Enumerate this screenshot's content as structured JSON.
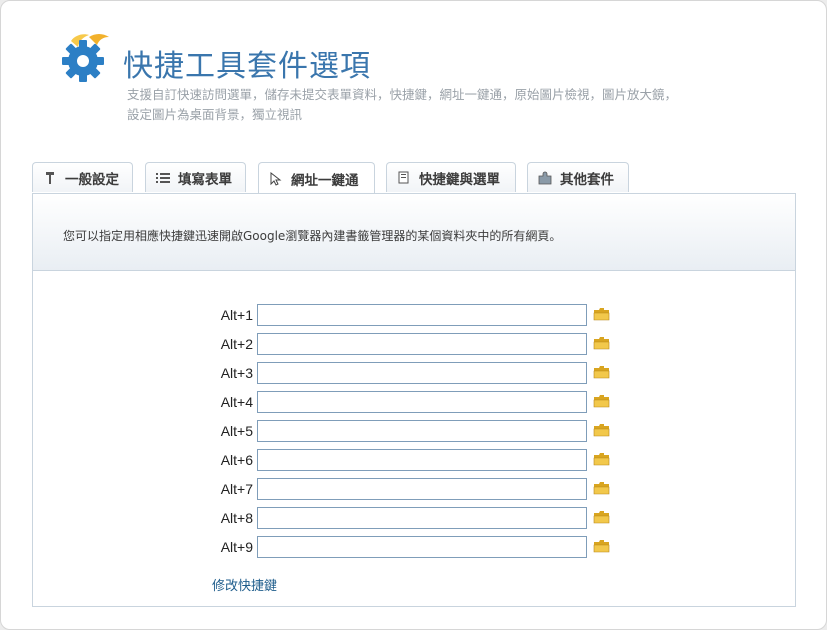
{
  "header": {
    "title": "快捷工具套件選項",
    "subtitle_line1": "支援自訂快速訪問選單，儲存未提交表單資料，快捷鍵，網址一鍵通，原始圖片檢視，圖片放大鏡，",
    "subtitle_line2": "設定圖片為桌面背景，獨立視訊"
  },
  "tabs": [
    {
      "label": "一般設定",
      "icon": "wrench-icon"
    },
    {
      "label": "填寫表單",
      "icon": "list-icon"
    },
    {
      "label": "網址一鍵通",
      "icon": "cursor-icon",
      "active": true
    },
    {
      "label": "快捷鍵與選單",
      "icon": "document-icon"
    },
    {
      "label": "其他套件",
      "icon": "puzzle-icon"
    }
  ],
  "info": {
    "text": "您可以指定用相應快捷鍵迅速開啟Google瀏覽器內建書籤管理器的某個資料夾中的所有網頁。"
  },
  "shortcuts": [
    {
      "label": "Alt+1",
      "value": ""
    },
    {
      "label": "Alt+2",
      "value": ""
    },
    {
      "label": "Alt+3",
      "value": ""
    },
    {
      "label": "Alt+4",
      "value": ""
    },
    {
      "label": "Alt+5",
      "value": ""
    },
    {
      "label": "Alt+6",
      "value": ""
    },
    {
      "label": "Alt+7",
      "value": ""
    },
    {
      "label": "Alt+8",
      "value": ""
    },
    {
      "label": "Alt+9",
      "value": ""
    }
  ],
  "modify_link": "修改快捷鍵",
  "colors": {
    "accent": "#3a76ad",
    "border": "#c9d4de",
    "folder": "#f2c84b"
  }
}
